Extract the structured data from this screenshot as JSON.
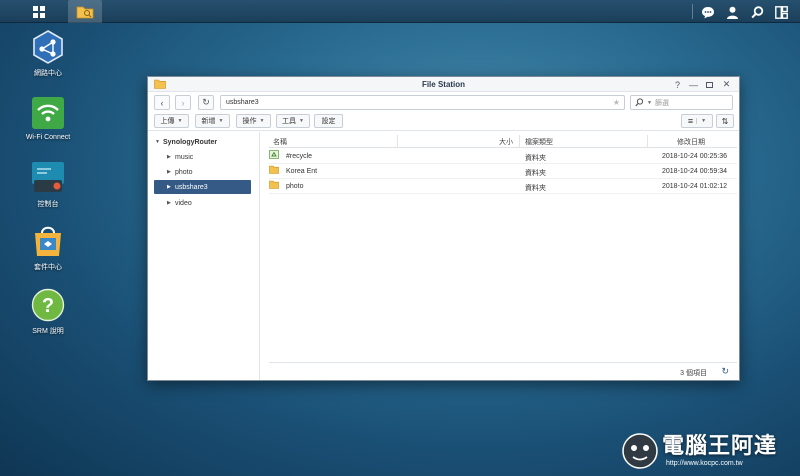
{
  "taskbar": {
    "main_menu_icon": "grid-icon",
    "active_app_icon": "file-station-icon",
    "right_icons": [
      "chat-icon",
      "user-icon",
      "search-icon",
      "widgets-icon"
    ]
  },
  "desktop": {
    "icons": [
      {
        "label": "網路中心",
        "icon": "network-center-icon"
      },
      {
        "label": "Wi-Fi Connect",
        "icon": "wifi-connect-icon"
      },
      {
        "label": "控制台",
        "icon": "control-panel-icon"
      },
      {
        "label": "套件中心",
        "icon": "package-center-icon"
      },
      {
        "label": "SRM 說明",
        "icon": "help-icon"
      }
    ]
  },
  "window": {
    "title": "File Station",
    "path": "usbshare3",
    "search_placeholder": "篩選",
    "toolbar": {
      "upload": "上傳",
      "create": "新增",
      "action": "操作",
      "tools": "工具",
      "settings": "設定"
    },
    "tree": {
      "root": "SynologyRouter",
      "items": [
        {
          "label": "music",
          "selected": false
        },
        {
          "label": "photo",
          "selected": false
        },
        {
          "label": "usbshare3",
          "selected": true
        },
        {
          "label": "video",
          "selected": false
        }
      ]
    },
    "columns": {
      "name": "名稱",
      "size": "大小",
      "type": "檔案類型",
      "modified": "修改日期"
    },
    "rows": [
      {
        "name": "#recycle",
        "size": "",
        "type": "資料夾",
        "modified": "2018-10-24 00:25:36",
        "icon": "recycle-folder-icon"
      },
      {
        "name": "Korea Ent",
        "size": "",
        "type": "資料夾",
        "modified": "2018-10-24 00:59:34",
        "icon": "folder-icon"
      },
      {
        "name": "photo",
        "size": "",
        "type": "資料夾",
        "modified": "2018-10-24 01:02:12",
        "icon": "folder-icon"
      }
    ],
    "footer": {
      "count": "3 個項目"
    }
  },
  "watermark": {
    "brand": "電腦王阿達",
    "url": "http://www.kocpc.com.tw"
  },
  "colors": {
    "selection": "#345a85",
    "folder": "#f2c14e"
  }
}
